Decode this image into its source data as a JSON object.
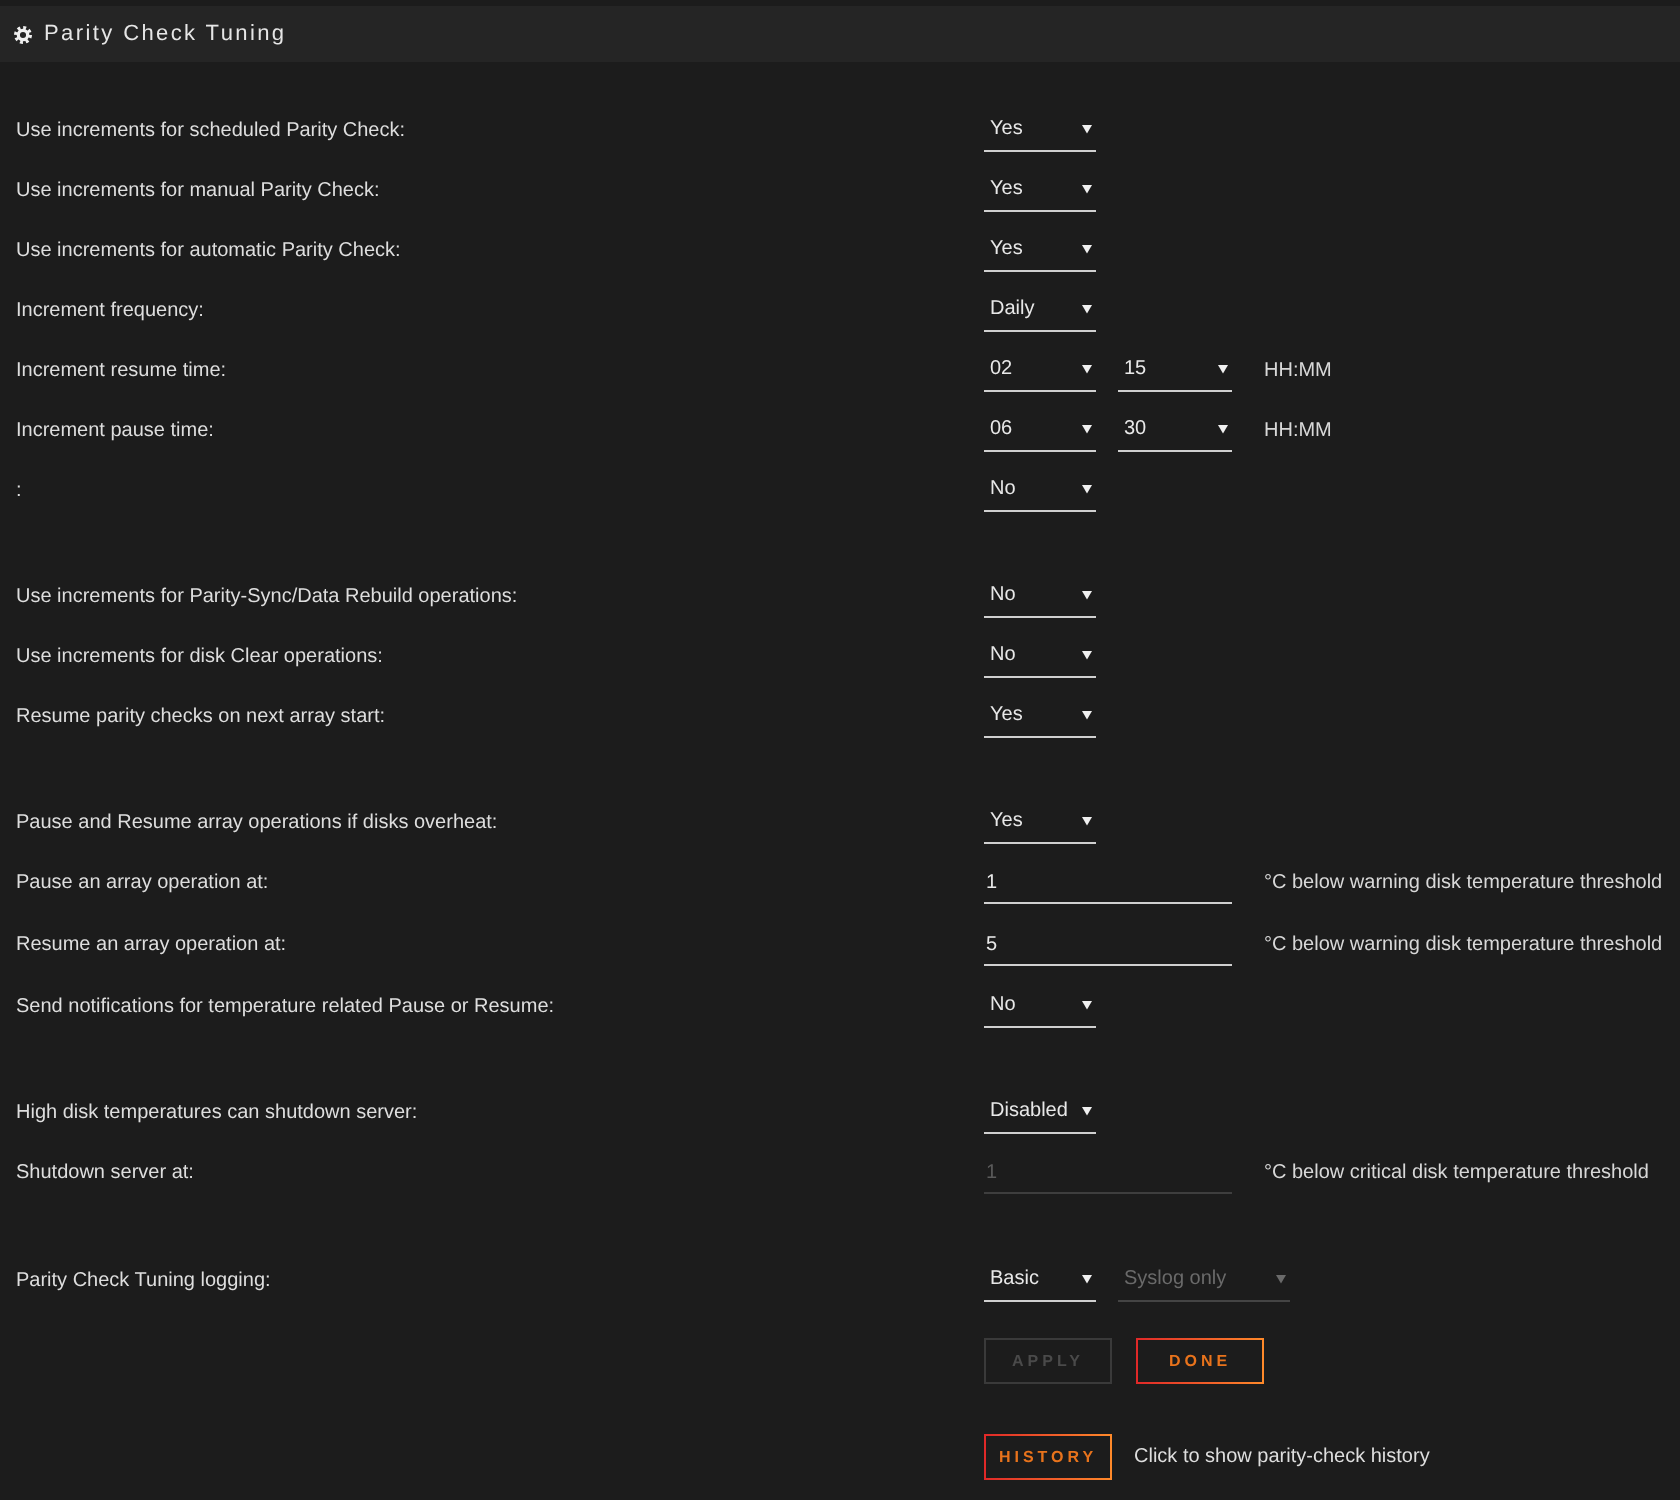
{
  "header": {
    "title": "Parity Check Tuning"
  },
  "groups": [
    {
      "rows": [
        {
          "label": "Use increments for scheduled Parity Check:",
          "controls": [
            {
              "kind": "select",
              "value": "Yes",
              "disabled": false
            }
          ]
        },
        {
          "label": "Use increments for manual Parity Check:",
          "controls": [
            {
              "kind": "select",
              "value": "Yes",
              "disabled": false
            }
          ]
        },
        {
          "label": "Use increments for automatic Parity Check:",
          "controls": [
            {
              "kind": "select",
              "value": "Yes",
              "disabled": false
            }
          ]
        },
        {
          "label": "Increment frequency:",
          "controls": [
            {
              "kind": "select",
              "value": "Daily",
              "disabled": false
            }
          ]
        },
        {
          "label": "Increment resume time:",
          "controls": [
            {
              "kind": "select",
              "value": "02",
              "disabled": false
            },
            {
              "kind": "select",
              "value": "15",
              "disabled": false
            }
          ],
          "suffix": "HH:MM"
        },
        {
          "label": "Increment pause time:",
          "controls": [
            {
              "kind": "select",
              "value": "06",
              "disabled": false
            },
            {
              "kind": "select",
              "value": "30",
              "disabled": false
            }
          ],
          "suffix": "HH:MM"
        },
        {
          "label": ":",
          "controls": [
            {
              "kind": "select",
              "value": "No",
              "disabled": false
            }
          ]
        }
      ]
    },
    {
      "rows": [
        {
          "label": "Use increments for Parity-Sync/Data Rebuild operations:",
          "controls": [
            {
              "kind": "select",
              "value": "No",
              "disabled": false
            }
          ]
        },
        {
          "label": "Use increments for disk Clear operations:",
          "controls": [
            {
              "kind": "select",
              "value": "No",
              "disabled": false
            }
          ]
        },
        {
          "label": "Resume parity checks on next array start:",
          "controls": [
            {
              "kind": "select",
              "value": "Yes",
              "disabled": false
            }
          ]
        }
      ]
    },
    {
      "rows": [
        {
          "label": "Pause and Resume array operations if disks overheat:",
          "controls": [
            {
              "kind": "select",
              "value": "Yes",
              "disabled": false
            }
          ]
        },
        {
          "label": "Pause an array operation at:",
          "controls": [
            {
              "kind": "input",
              "value": "1",
              "disabled": false
            }
          ],
          "suffix": "°C below warning disk temperature threshold"
        },
        {
          "label": "Resume an array operation at:",
          "controls": [
            {
              "kind": "input",
              "value": "5",
              "disabled": false
            }
          ],
          "suffix": "°C below warning disk temperature threshold"
        },
        {
          "label": "Send notifications for temperature related Pause or Resume:",
          "controls": [
            {
              "kind": "select",
              "value": "No",
              "disabled": false
            }
          ]
        }
      ]
    },
    {
      "rows": [
        {
          "label": "High disk temperatures can shutdown server:",
          "controls": [
            {
              "kind": "select",
              "value": "Disabled",
              "disabled": false
            }
          ]
        },
        {
          "label": "Shutdown server at:",
          "controls": [
            {
              "kind": "input",
              "value": "1",
              "disabled": true
            }
          ],
          "suffix": "°C below critical disk temperature threshold"
        }
      ]
    },
    {
      "rows": [
        {
          "label": "Parity Check Tuning logging:",
          "controls": [
            {
              "kind": "select",
              "value": "Basic",
              "disabled": false
            },
            {
              "kind": "select",
              "value": "Syslog only",
              "disabled": true
            }
          ]
        }
      ]
    }
  ],
  "actions": [
    {
      "label": "APPLY",
      "disabled": true
    },
    {
      "label": "DONE",
      "disabled": false
    }
  ],
  "history": {
    "button": "HISTORY",
    "note": "Click to show parity-check history"
  }
}
